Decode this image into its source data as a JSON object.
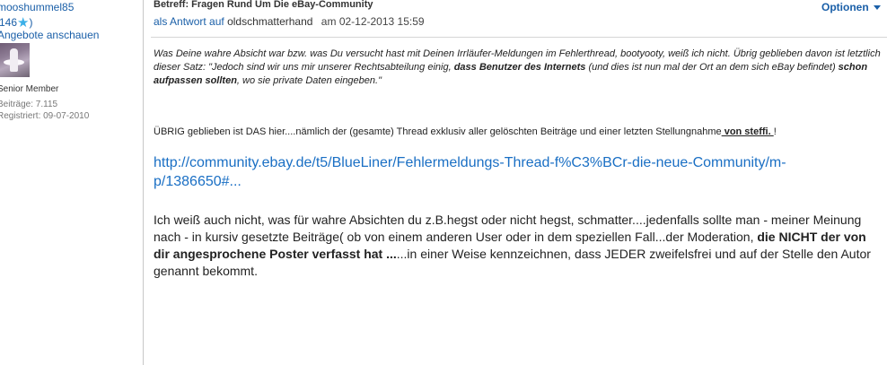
{
  "author": {
    "username": "mooshummel85",
    "kudos": "146",
    "kudos_close": ")",
    "offers_link": "Angebote anschauen",
    "rank": "Senior Member",
    "posts": "Beiträge: 7.115",
    "registered": "Registriert: 09-07-2010"
  },
  "post": {
    "subject": "Betreff: Fragen Rund Um Die eBay-Community",
    "reply_link": "als Antwort auf",
    "reply_to": "oldschmatterhand",
    "date_prefix": "am",
    "date": "02-12-2013 15:59",
    "options": "Optionen",
    "quote": {
      "part1": "Was Deine wahre Absicht war bzw. was Du versucht hast mit Deinen Irrläufer-Meldungen im Fehlerthread, bootyooty, weiß ich nicht. Übrig geblieben davon ist letztlich dieser Satz: \"Jedoch sind wir uns mir unserer Rechtsabteilung einig, ",
      "bold1": "dass Benutzer des Internets",
      "part2": " (und dies ist nun mal der Ort an dem sich eBay befindet) ",
      "bold2": "schon aufpassen sollten",
      "part3": ", wo sie private Daten eingeben.\""
    },
    "uebrig": {
      "text": "ÜBRIG geblieben ist DAS hier....nämlich der (gesamte) Thread exklusiv aller gelöschten Beiträge und einer letzten Stellungnahme",
      "steffi": " von steffi. ",
      "end": "!"
    },
    "thread_link": "http://community.ebay.de/t5/BlueLiner/Fehlermeldungs-Thread-f%C3%BCr-die-neue-Community/m-p/1386650#...",
    "body": {
      "part1": "Ich weiß auch nicht, was für wahre Absichten du z.B.hegst oder nicht hegst, schmatter....jedenfalls sollte man - meiner Meinung nach - in kursiv gesetzte Beiträge( ob von einem anderen User oder in dem speziellen Fall...der Moderation, ",
      "bold": "die NICHT der von dir angesprochene Poster verfasst hat ...",
      "part2": "...in einer Weise kennzeichnen, dass JEDER zweifelsfrei und auf der Stelle den Autor genannt bekommt."
    }
  },
  "colors": {
    "link": "#1a5fa8",
    "star": "#3bb0e8"
  },
  "icons": {
    "kudos": "star-icon",
    "options": "caret-down-icon"
  }
}
